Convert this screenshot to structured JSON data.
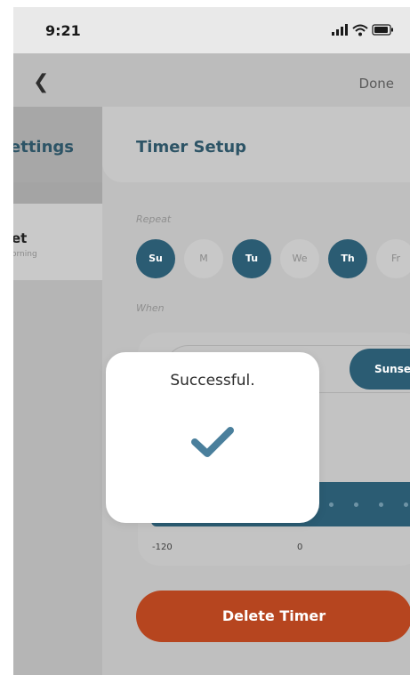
{
  "status_bar": {
    "time": "9:21",
    "icons": [
      "signal-icon",
      "wifi-icon",
      "battery-icon"
    ]
  },
  "nav": {
    "back_icon": "chevron-left-icon",
    "done_label": "Done"
  },
  "left_panel": {
    "title": "ettings",
    "item_title": "et",
    "item_subtitle": "orning"
  },
  "timer_setup": {
    "title": "Timer Setup",
    "repeat_label": "Repeat",
    "days": [
      {
        "label": "Su",
        "selected": true
      },
      {
        "label": "M",
        "selected": false
      },
      {
        "label": "Tu",
        "selected": true
      },
      {
        "label": "We",
        "selected": false
      },
      {
        "label": "Th",
        "selected": true
      },
      {
        "label": "Fr",
        "selected": false
      }
    ],
    "when_label": "When",
    "when_segments": {
      "selected": "Sunset"
    },
    "offset_ticks": [
      "-120",
      "0"
    ],
    "delete_label": "Delete Timer"
  },
  "modal": {
    "message": "Successful.",
    "icon": "checkmark-icon"
  },
  "colors": {
    "accent": "#2b5c73",
    "danger": "#b6451f",
    "overlay": "#bdbdbd",
    "modal": "#ffffff",
    "check": "#4a7f9c"
  }
}
